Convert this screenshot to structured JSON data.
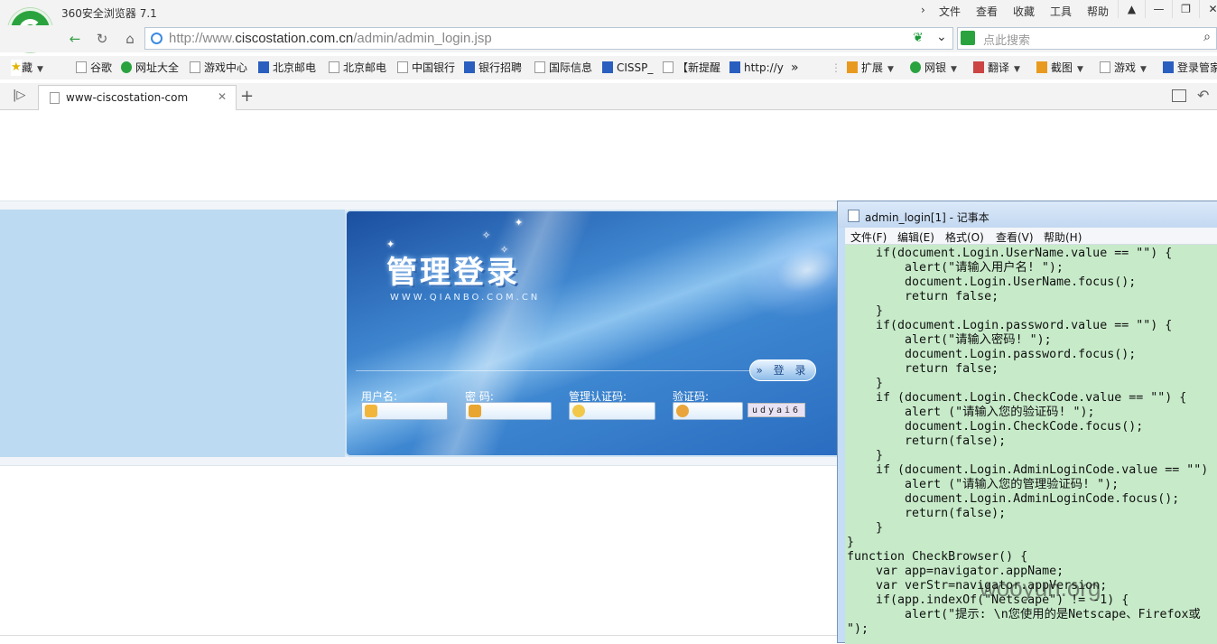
{
  "browser": {
    "app_title": "360安全浏览器 7.1",
    "menu": [
      "文件",
      "查看",
      "收藏",
      "工具",
      "帮助"
    ],
    "url_prefix": "http://www.",
    "url_domain": "ciscostation.com.cn",
    "url_path": "/admin/admin_login.jsp",
    "search_placeholder": "点此搜索"
  },
  "bookmarks": [
    {
      "label": "收藏",
      "icon": "star-icon"
    },
    {
      "label": "谷歌",
      "icon": "page-icon"
    },
    {
      "label": "网址大全",
      "icon": "green-circle-icon"
    },
    {
      "label": "游戏中心",
      "icon": "gamepad-icon"
    },
    {
      "label": "北京邮电",
      "icon": "butterfly-icon"
    },
    {
      "label": "北京邮电",
      "icon": "page-icon"
    },
    {
      "label": "中国银行",
      "icon": "page-icon"
    },
    {
      "label": "银行招聘",
      "icon": "paw-icon"
    },
    {
      "label": "国际信息",
      "icon": "page-icon"
    },
    {
      "label": "CISSP_",
      "icon": "paw-icon"
    },
    {
      "label": "【新提醒",
      "icon": "page-icon"
    },
    {
      "label": "http://y",
      "icon": "ie-icon"
    }
  ],
  "toolbar_right": [
    {
      "label": "扩展",
      "icon": "extension-icon"
    },
    {
      "label": "网银",
      "icon": "bank-icon"
    },
    {
      "label": "翻译",
      "icon": "translate-icon"
    },
    {
      "label": "截图",
      "icon": "scissors-icon"
    },
    {
      "label": "游戏",
      "icon": "gamepad-icon"
    },
    {
      "label": "登录管家",
      "icon": "search-key-icon"
    }
  ],
  "tab": {
    "title": "www-ciscostation-com"
  },
  "login": {
    "title": "管理登录",
    "subtitle": "WWW.QIANBO.COM.CN",
    "username_label": "用户名:",
    "password_label": "密  码:",
    "admin_code_label": "管理认证码:",
    "captcha_label": "验证码:",
    "captcha_text": "udyai6",
    "login_button": "» 登 录"
  },
  "notepad": {
    "title": "admin_login[1] - 记事本",
    "menu": [
      "文件(F)",
      "编辑(E)",
      "格式(O)",
      "查看(V)",
      "帮助(H)"
    ],
    "code_lines": [
      "    if(document.Login.UserName.value == \"\") {",
      "        alert(\"请输入用户名! \");",
      "        document.Login.UserName.focus();",
      "        return false;",
      "    }",
      "    if(document.Login.password.value == \"\") {",
      "        alert(\"请输入密码! \");",
      "        document.Login.password.focus();",
      "        return false;",
      "    }",
      "    if (document.Login.CheckCode.value == \"\") {",
      "        alert (\"请输入您的验证码! \");",
      "        document.Login.CheckCode.focus();",
      "        return(false);",
      "    }",
      "    if (document.Login.AdminLoginCode.value == \"\")",
      "        alert (\"请输入您的管理验证码! \");",
      "        document.Login.AdminLoginCode.focus();",
      "        return(false);",
      "    }",
      "}",
      "function CheckBrowser() {",
      "    var app=navigator.appName;",
      "    var verStr=navigator.appVersion;",
      "    if(app.indexOf(\"Netscape\") != -1) {",
      "        alert(\"提示: \\n您使用的是Netscape、Firefox或",
      "\");"
    ]
  },
  "watermark": "wooyun.org"
}
